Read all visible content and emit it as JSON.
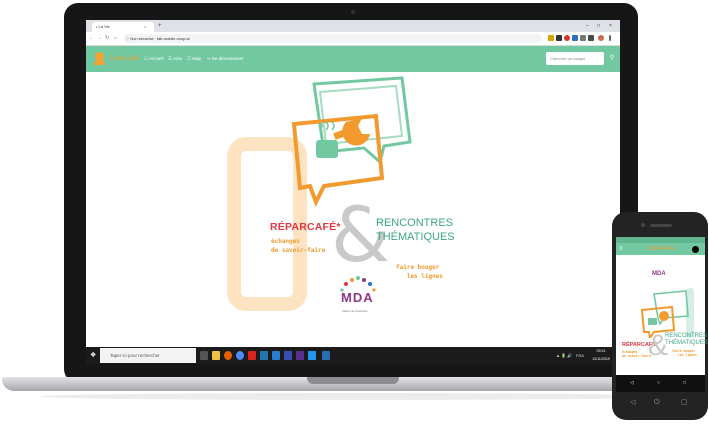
{
  "browser": {
    "tab_title": "• La Vie",
    "tab_close": "×",
    "new_tab": "+",
    "min": "–",
    "max": "□",
    "close": "×",
    "not_secure": "Non sécurisé",
    "url": "fab-mobile.coop.ai",
    "nav_icons": [
      "←",
      "→",
      "↻",
      "⌂"
    ]
  },
  "site": {
    "brand": "Coop Café",
    "menu": [
      "☖ Accueil",
      "☰ Actu",
      "☷ Map",
      "↪ Se déconnecter"
    ],
    "search_placeholder": "Chercher un usager",
    "search_icon": "magnifier-icon"
  },
  "poster": {
    "title_left": "RÉPARCAFÉ*",
    "subtitle_left": "échanges\nde savoir-faire",
    "ampersand": "&",
    "title_right": "RENCONTRES\nTHÉMATIQUES",
    "subtitle_right": "faire bouger\n   les lignes",
    "mda": "MDA",
    "mda_sub": "Maison de l'Autonomie",
    "colors": {
      "orange": "#f29a2e",
      "green": "#72c9a1",
      "red": "#e23743",
      "purple": "#8b3a88"
    }
  },
  "taskbar": {
    "search_placeholder": "Taper ici pour rechercher",
    "tray_text": "FRA",
    "time": "09:21",
    "date": "12/11/2019"
  },
  "phone": {
    "brand": "COOPCAFÉ",
    "menu_icon": "≡",
    "nav_buttons": [
      "◁",
      "○",
      "□"
    ],
    "hardware": [
      "◁",
      "⏻",
      "▢"
    ]
  }
}
